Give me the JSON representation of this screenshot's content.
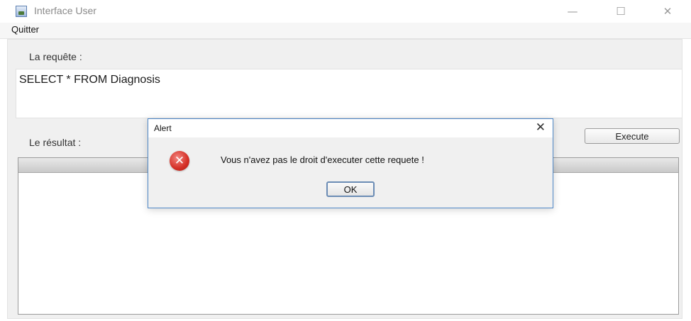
{
  "window": {
    "title": "Interface User",
    "minimize_icon": "—",
    "maximize_icon": "☐",
    "close_icon": "✕"
  },
  "menu": {
    "items": [
      {
        "label": "Quitter"
      }
    ]
  },
  "form": {
    "query_label": "La requête :",
    "query_value": "SELECT * FROM Diagnosis",
    "result_label": "Le résultat :",
    "execute_label": "Execute"
  },
  "dialog": {
    "title": "Alert",
    "close_icon": "✕",
    "error_icon": "error-icon",
    "error_glyph": "✕",
    "message": "Vous n'avez pas le droit d'executer cette requete !",
    "ok_label": "OK"
  },
  "colors": {
    "dialog_border": "#4d87c7",
    "error_red": "#d42f26"
  }
}
